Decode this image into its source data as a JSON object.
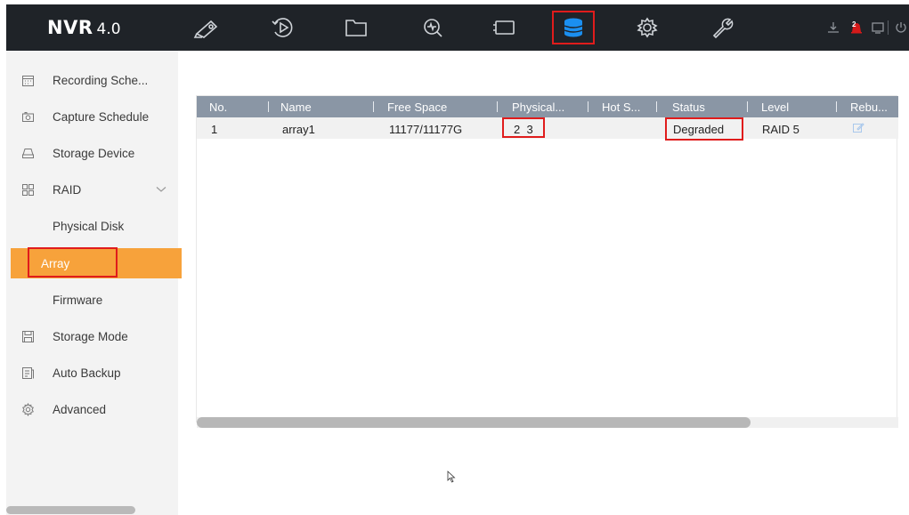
{
  "brand": {
    "name": "NVR",
    "version": "4.0"
  },
  "nav_icons": [
    "live-view-icon",
    "playback-icon",
    "file-icon",
    "search-icon",
    "display-icon",
    "storage-icon",
    "settings-icon",
    "maintenance-icon"
  ],
  "top_right_icons": [
    "download-icon",
    "alarm-icon",
    "monitor-icon",
    "power-icon"
  ],
  "alarm_badge": "2",
  "colors": {
    "topbar": "#1f2328",
    "accent": "#f7a23b",
    "highlight": "#e01c1c",
    "storage_icon": "#1b8ff0",
    "table_header": "#8a96a5"
  },
  "sidebar": {
    "items": [
      {
        "label": "Recording Sche...",
        "icon": "calendar-icon"
      },
      {
        "label": "Capture Schedule",
        "icon": "camera-icon"
      },
      {
        "label": "Storage Device",
        "icon": "hdd-icon"
      },
      {
        "label": "RAID",
        "icon": "raid-grid-icon"
      },
      {
        "label": "Physical Disk"
      },
      {
        "label": "Array"
      },
      {
        "label": "Firmware"
      },
      {
        "label": "Storage Mode",
        "icon": "save-icon"
      },
      {
        "label": "Auto Backup",
        "icon": "backup-icon"
      },
      {
        "label": "Advanced",
        "icon": "gear-icon"
      }
    ],
    "active": "Array"
  },
  "table": {
    "columns": [
      "No.",
      "Name",
      "Free Space",
      "Physical...",
      "Hot S...",
      "Status",
      "Level",
      "Rebu..."
    ],
    "rows": [
      {
        "no": "1",
        "name": "array1",
        "free_space": "11177/11177G",
        "physical": "2  3",
        "hot_spare": "",
        "status": "Degraded",
        "level": "RAID 5"
      }
    ]
  }
}
